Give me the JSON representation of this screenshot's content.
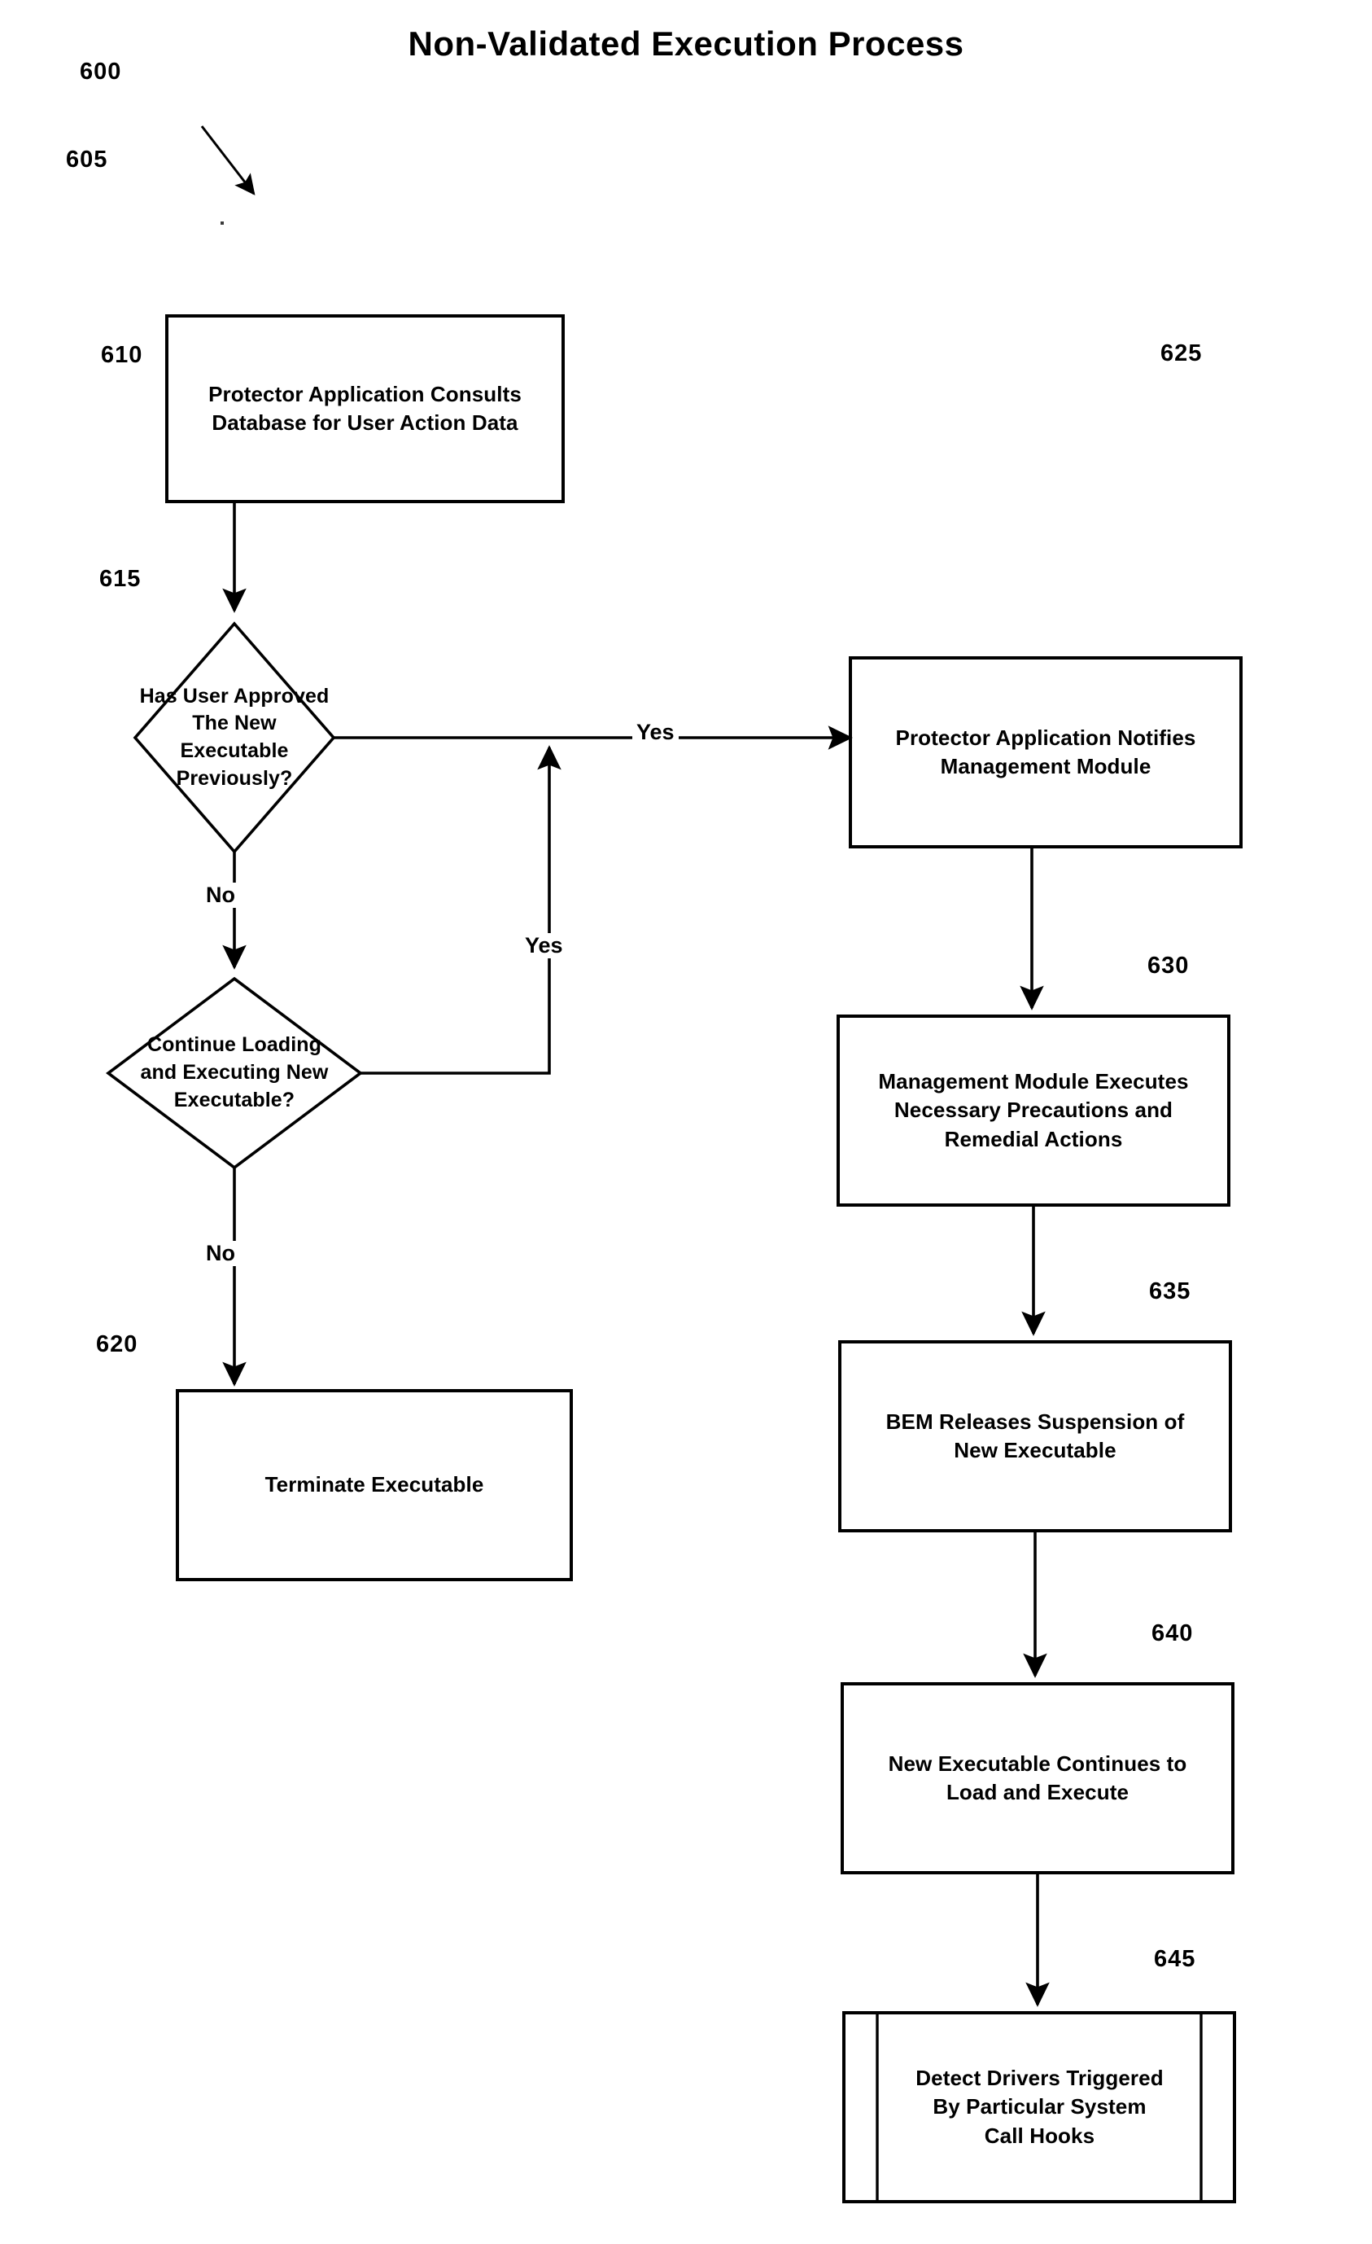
{
  "figure": {
    "title": "Non-Validated Execution Process",
    "figure_ref": "600",
    "type": "flowchart"
  },
  "chart_data": {
    "type": "diagram",
    "title": "Non-Validated Execution Process",
    "nodes": [
      {
        "ref": "605",
        "shape": "process",
        "text": "Protector Application Consults\nDatabase for User Action Data"
      },
      {
        "ref": "610",
        "shape": "decision",
        "text": "Has User Approved\nThe New\nExecutable\nPreviously?"
      },
      {
        "ref": "615",
        "shape": "decision",
        "text": "Continue Loading\nand Executing New\nExecutable?"
      },
      {
        "ref": "620",
        "shape": "process",
        "text": "Terminate Executable"
      },
      {
        "ref": "625",
        "shape": "process",
        "text": "Protector Application Notifies\nManagement Module"
      },
      {
        "ref": "630",
        "shape": "process",
        "text": "Management Module Executes\nNecessary Precautions and\nRemedial Actions"
      },
      {
        "ref": "635",
        "shape": "process",
        "text": "BEM Releases Suspension of\nNew Executable"
      },
      {
        "ref": "640",
        "shape": "process",
        "text": "New Executable Continues to\nLoad and Execute"
      },
      {
        "ref": "645",
        "shape": "predefined-process",
        "text": "Detect Drivers Triggered\nBy Particular System\nCall Hooks"
      }
    ],
    "edges": [
      {
        "from": "605",
        "to": "610",
        "label": ""
      },
      {
        "from": "610",
        "to": "625",
        "label": "Yes"
      },
      {
        "from": "610",
        "to": "615",
        "label": "No"
      },
      {
        "from": "615",
        "to": "610_yes_line",
        "label": "Yes"
      },
      {
        "from": "615",
        "to": "620",
        "label": "No"
      },
      {
        "from": "625",
        "to": "630",
        "label": ""
      },
      {
        "from": "630",
        "to": "635",
        "label": ""
      },
      {
        "from": "635",
        "to": "640",
        "label": ""
      },
      {
        "from": "640",
        "to": "645",
        "label": ""
      }
    ]
  },
  "nodes": {
    "n605": {
      "ref": "605",
      "text": "Protector Application Consults\nDatabase for User Action Data"
    },
    "n610": {
      "ref": "610",
      "text": "Has User Approved\nThe New\nExecutable\nPreviously?"
    },
    "n615": {
      "ref": "615",
      "text": "Continue Loading\nand Executing New\nExecutable?"
    },
    "n620": {
      "ref": "620",
      "text": "Terminate Executable"
    },
    "n625": {
      "ref": "625",
      "text": "Protector Application Notifies\nManagement Module"
    },
    "n630": {
      "ref": "630",
      "text": "Management Module Executes\nNecessary Precautions and\nRemedial Actions"
    },
    "n635": {
      "ref": "635",
      "text": "BEM Releases Suspension of\nNew Executable"
    },
    "n640": {
      "ref": "640",
      "text": "New Executable Continues to\nLoad and Execute"
    },
    "n645": {
      "ref": "645",
      "text": "Detect Drivers Triggered\nBy Particular System\nCall Hooks"
    }
  },
  "edge_labels": {
    "yes_610_to_625": "Yes",
    "no_610_to_615": "No",
    "yes_615_loopback": "Yes",
    "no_615_to_620": "No"
  }
}
